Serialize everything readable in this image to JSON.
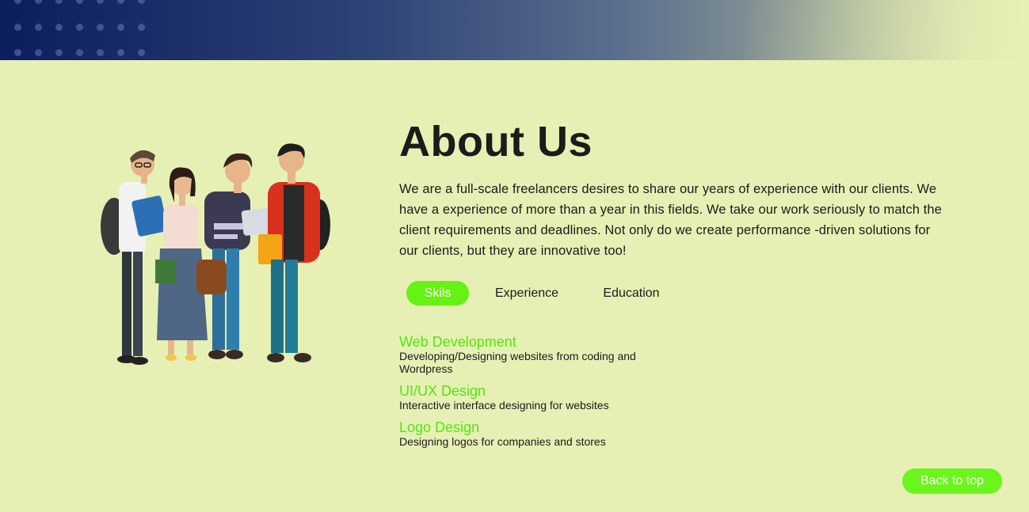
{
  "about": {
    "title": "About Us",
    "paragraph": "We are a full-scale freelancers desires to share our years of experience with our clients. We have a experience of more than a year in this fields. We take our work seriously to match the client requirements and deadlines. Not only do we create performance -driven solutions for our clients, but they are innovative too!"
  },
  "tabs": [
    {
      "label": "Skils",
      "active": true
    },
    {
      "label": "Experience",
      "active": false
    },
    {
      "label": "Education",
      "active": false
    }
  ],
  "skills": [
    {
      "title": "Web Development",
      "desc": "Developing/Designing websites from coding and Wordpress"
    },
    {
      "title": "UI/UX Design",
      "desc": "Interactive interface designing for websites"
    },
    {
      "title": "Logo Design",
      "desc": "Designing logos for companies and stores"
    }
  ],
  "back_to_top": "Back to top",
  "illustration": {
    "icon": "team-illustration"
  },
  "colors": {
    "accent": "#66f213",
    "skill_title": "#55e60c",
    "background": "#e6f0b4",
    "banner_dark": "#0c1d5e"
  }
}
